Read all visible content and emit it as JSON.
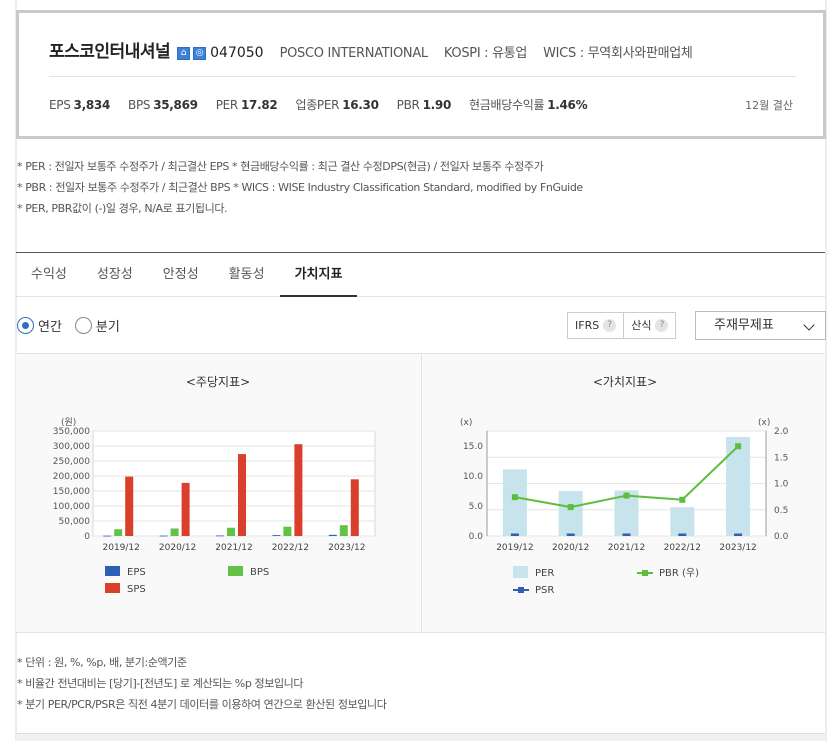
{
  "company": {
    "name": "포스코인터내셔널",
    "icons": [
      "home-icon",
      "ir-icon"
    ],
    "icon_glyphs": [
      "⌂",
      "◎"
    ],
    "code": "047050",
    "english_name": "POSCO INTERNATIONAL",
    "market": "KOSPI : 유통업",
    "wics": "WICS : 무역회사와판매업체",
    "fiscal": "12월 결산"
  },
  "stats": [
    {
      "label": "EPS",
      "value": "3,834"
    },
    {
      "label": "BPS",
      "value": "35,869"
    },
    {
      "label": "PER",
      "value": "17.82"
    },
    {
      "label": "업종PER",
      "value": "16.30"
    },
    {
      "label": "PBR",
      "value": "1.90"
    },
    {
      "label": "현금배당수익률",
      "value": "1.46%"
    }
  ],
  "notes": [
    "* PER : 전일자 보통주 수정주가 / 최근결산 EPS * 현금배당수익률 : 최근 결산 수정DPS(현금) / 전일자 보통주 수정주가",
    "* PBR : 전일자 보통주 수정주가 / 최근결산 BPS * WICS : WISE Industry Classification Standard, modified by FnGuide",
    "* PER, PBR값이 (-)일 경우, N/A로 표기됩니다."
  ],
  "tabs": [
    {
      "label": "수익성",
      "active": false
    },
    {
      "label": "성장성",
      "active": false
    },
    {
      "label": "안정성",
      "active": false
    },
    {
      "label": "활동성",
      "active": false
    },
    {
      "label": "가치지표",
      "active": true
    }
  ],
  "period": {
    "annual": "연간",
    "quarterly": "분기",
    "selected": "annual"
  },
  "buttons": {
    "ifrs": "IFRS",
    "calc": "산식",
    "help_glyph": "?"
  },
  "select": {
    "value": "주재무제표"
  },
  "footnotes": [
    "* 단위 : 원, %, %p, 배, 분기:순액기준",
    "* 비율간 전년대비는 [당기]-[전년도] 로 계산되는 %p 정보입니다",
    "* 분기 PER/PCR/PSR은 직전 4분기 데이터를 이용하여 연간으로 환산된 정보입니다"
  ],
  "chart_data": [
    {
      "type": "bar",
      "title": "<주당지표>",
      "ylabel": "(원)",
      "ylim": [
        0,
        350000
      ],
      "yticks": [
        "0",
        "50,000",
        "100,000",
        "150,000",
        "200,000",
        "250,000",
        "300,000",
        "350,000"
      ],
      "categories": [
        "2019/12",
        "2020/12",
        "2021/12",
        "2022/12",
        "2023/12"
      ],
      "legend_position": "bottom",
      "grid": true,
      "series": [
        {
          "name": "EPS",
          "color": "#2e5fb5",
          "values": [
            1200,
            1300,
            1700,
            2900,
            3834
          ]
        },
        {
          "name": "BPS",
          "color": "#62c246",
          "values": [
            22500,
            25000,
            27500,
            31000,
            35869
          ]
        },
        {
          "name": "SPS",
          "color": "#d93f2a",
          "values": [
            198000,
            177000,
            273000,
            306000,
            189000
          ]
        }
      ]
    },
    {
      "type": "bar",
      "title": "<가치지표>",
      "ylabel": "(x)",
      "y2label": "(x)",
      "ylim": [
        0,
        17.5
      ],
      "y2lim": [
        0,
        2.0
      ],
      "yticks": [
        "0.0",
        "5.0",
        "10.0",
        "15.0"
      ],
      "y2ticks": [
        "0.0",
        "0.5",
        "1.0",
        "1.5",
        "2.0"
      ],
      "categories": [
        "2019/12",
        "2020/12",
        "2021/12",
        "2022/12",
        "2023/12"
      ],
      "legend_position": "bottom",
      "grid": true,
      "series": [
        {
          "name": "PER",
          "kind": "bar",
          "axis": "left",
          "color": "#c7e3eb",
          "values": [
            11.1,
            7.5,
            7.6,
            4.8,
            16.5
          ]
        },
        {
          "name": "PBR (우)",
          "kind": "line",
          "axis": "right",
          "color": "#5cbf3c",
          "values": [
            0.74,
            0.55,
            0.77,
            0.69,
            1.71
          ]
        },
        {
          "name": "PSR",
          "kind": "bar",
          "axis": "left",
          "color": "#2e5fb5",
          "values": [
            0.07,
            0.05,
            0.06,
            0.05,
            0.33
          ]
        }
      ]
    }
  ]
}
